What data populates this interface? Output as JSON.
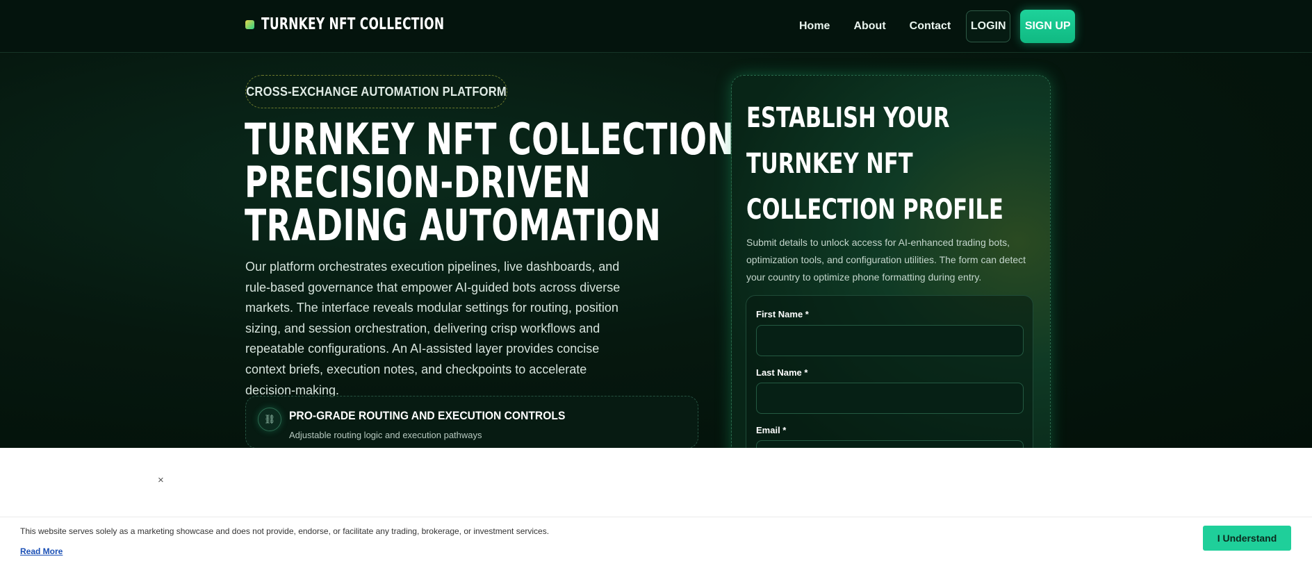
{
  "header": {
    "brand": "TURNKEY NFT COLLECTION",
    "nav": [
      "Home",
      "About",
      "Contact"
    ],
    "login_label": "LOGIN",
    "signup_label": "SIGN UP"
  },
  "hero": {
    "badge": "CROSS-EXCHANGE AUTOMATION PLATFORM",
    "title_lines": [
      "TURNKEY NFT COLLECTION:",
      "PRECISION-DRIVEN",
      "TRADING AUTOMATION"
    ],
    "description": "Our platform orchestrates execution pipelines, live dashboards, and rule-based governance that empower AI-guided bots across diverse markets. The interface reveals modular settings for routing, position sizing, and session orchestration, delivering crisp workflows and repeatable configurations. An AI-assisted layer provides concise context briefs, execution notes, and checkpoints to accelerate decision-making.",
    "feature": {
      "icon": "link-icon",
      "title": "PRO-GRADE ROUTING AND EXECUTION CONTROLS",
      "subtitle": "Adjustable routing logic and execution pathways"
    }
  },
  "form": {
    "title_lines": [
      "ESTABLISH YOUR",
      "TURNKEY NFT",
      "COLLECTION PROFILE"
    ],
    "description": "Submit details to unlock access for AI-enhanced trading bots, optimization tools, and configuration utilities. The form can detect your country to optimize phone formatting during entry.",
    "fields": [
      {
        "label": "First Name *",
        "value": ""
      },
      {
        "label": "Last Name *",
        "value": ""
      },
      {
        "label": "Email *",
        "value": ""
      }
    ]
  },
  "cookie": {
    "close": "×",
    "text": "This website serves solely as a marketing showcase and does not provide, endorse, or facilitate any trading, brokerage, or investment services.",
    "read_more": "Read More",
    "accept_label": "I Understand"
  },
  "colors": {
    "accent": "#1ed29a",
    "background": "#04140e",
    "cookie_button": "#1fcf9a"
  }
}
